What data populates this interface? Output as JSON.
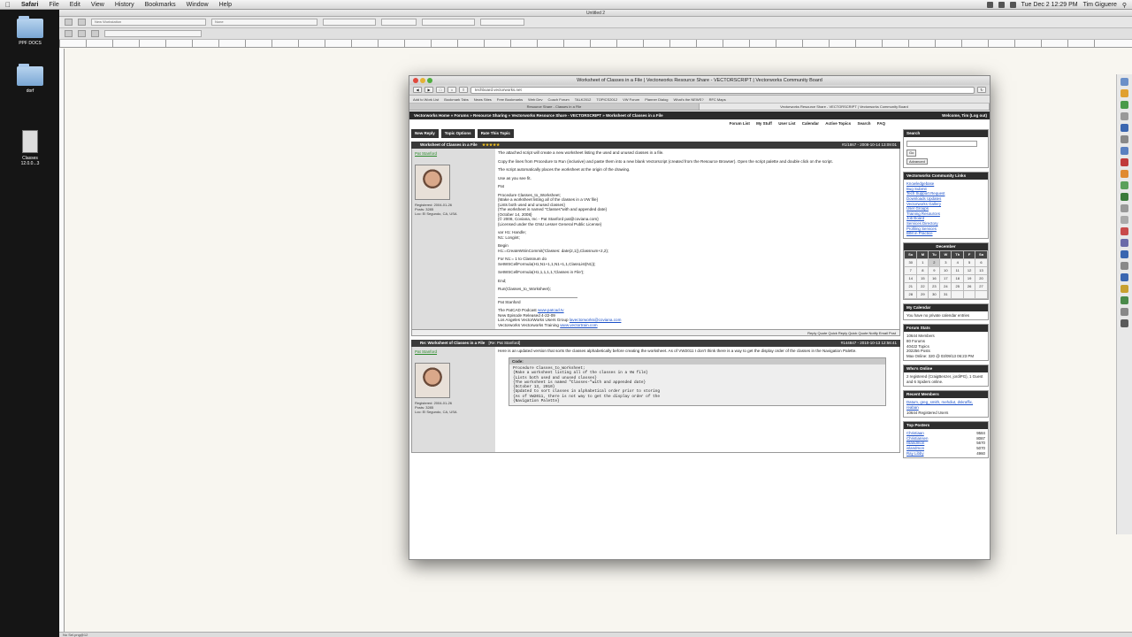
{
  "menubar": {
    "items": [
      "Safari",
      "File",
      "Edit",
      "View",
      "History",
      "Bookmarks",
      "Window",
      "Help"
    ],
    "clock": "Tue Dec 2  12:29 PM",
    "user": "Tim Giguere"
  },
  "desktop": {
    "icons": [
      "PPF DOCS",
      "dorf",
      "Classes 12.0.0...3"
    ]
  },
  "vw": {
    "title": "Untitled 2",
    "layer_box": "New Workstation",
    "class_box": "None",
    "status": "No Sel.png@12"
  },
  "safari": {
    "title": "Worksheet of Classes in a File | Vectorworks Resource Share - VECTORSCRIPT | Vectorworks Community Board",
    "url": "techboard.vectorworks.net",
    "bookmarks": [
      "Add to Work List",
      "Bookmark Tabs",
      "News Sites",
      "Free Bookmarks",
      "Web Dev",
      "Coach Forum",
      "TALK2012",
      "TOPICS2012",
      "VW Forum",
      "Planner Dialog",
      "What's the NEWS?",
      "RFC Maps"
    ],
    "tabs": [
      "Resource Share - Classes in a File",
      "Vectorworks Resource Share - VECTORSCRIPT | Vectorworks Community Board"
    ]
  },
  "forum": {
    "breadcrumb": "Vectorworks Home » Forums » Resource Sharing » Vectorworks Resource Share - VECTORSCRIPT » Worksheet of Classes in a File",
    "welcome": "Welcome, Tim (Log out)",
    "links": [
      "Forum List",
      "My Stuff",
      "User List",
      "Calendar",
      "Active Topics",
      "Search",
      "FAQ"
    ],
    "buttons": [
      "New Reply",
      "Topic Options",
      "Rate This Topic"
    ],
    "post1": {
      "subject": "Worksheet of Classes in a File",
      "date": "#1/1867 - 2008-10-14 13:09:01",
      "user": "Pat Stanford",
      "user_meta": [
        "Registered: 2004-01-26",
        "Posts: 3285",
        "Loc: El Segundo, CA, USA"
      ],
      "paragraphs": [
        "The attached script will create a new worksheet listing the used and unused classes in a file.",
        "Copy the lines from Procedure to Run (inclusive) and paste them into a new blank Vectorscript (created from the Resource Browser). Open the script palette and double click on the script.",
        "The script automatically places the worksheet at the origin of the drawing.",
        "Use as you see fit.",
        "Pat"
      ],
      "code_lines": [
        "Procedure Classes_to_Worksheet;",
        "{Make a worksheet listing all of the classes in a VW file}",
        "{Lists both used and unused classes}",
        "{The worksheet is named \"Classes\"with and appended date}",
        "{October 14, 2008}",
        "{© 2008, Coviana, Inc - Pat Stanford pat@coviana.com}",
        "{Licensed under the GNU Lesser General Public License}",
        "",
        "var H1: Handle;",
        "N1: Longint;",
        "",
        "Begin",
        "H1:=CreateWSinCommit('Classes: date(2,1)),Classnum+2,2);",
        "",
        "For N1:= 1 to Classnum do",
        "SetWSCellFormula(H1,N1+1,1,N1+1,1,ClassList(N1));",
        "",
        "SetWSCellFormula(H1,1,1,1,1,'Classes in File');",
        "",
        "End;",
        "",
        "Run(Classes_to_Worksheet);"
      ],
      "sig_name": "Pat Stanford",
      "sig_line1_prefix": "The PatCAD Podcast",
      "sig_line1_link": "www.patcad.tv",
      "sig_line2": "New Episode Released 4-22-09",
      "sig_line3_prefix": "Los Angeles VectorWorks Users Group",
      "sig_line3_link": "lavectorworks@coviana.com",
      "sig_line4_prefix": "Vectorworks Vectorworks Training",
      "sig_line4_link": "www.vectortrain.com",
      "actions": "Reply  Quote  Quick Reply  Quick Quote  Notify  Email Post"
    },
    "post2": {
      "subject": "Re: Worksheet of Classes in a File",
      "subject_by": "[Re: Pat Stanford]",
      "date": "#144847 - 2010-10-13 12:56:41",
      "user": "Pat Stanford",
      "user_meta": [
        "Registered: 2004-01-26",
        "Posts: 3285",
        "Loc: El Segundo, CA, USA"
      ],
      "intro": "Here is an updated version that sorts the classes alphabetically before creating the worksheet. As of VW2011 I don't think there is a way to get the display order of the classes in the Navigation Palette.",
      "code_label": "Code:",
      "code": "Procedure Classes_to_Worksheet;\n{Make a worksheet listing all of the classes in a VW file}\n{Lists both used and unused classes}\n{The worksheet is named \"Classes-\"with and appended date}\n{October 13, 2010}\n{Updated to sort classes in alphabetical order prior to storing\n{As of VW2011, there is not way to get the display order of the\n{Navigation Palette}"
    }
  },
  "sidebar": {
    "search_title": "Search",
    "search_go": "Go",
    "search_advanced": "Advanced",
    "links_title": "Vectorworks Community Links",
    "links": [
      "Knowledgebase",
      "Bug Submit",
      "Tech Support Request",
      "Downloads Updates",
      "Vectorworks Gallery",
      "User Groups",
      "Training Resources",
      "Job Board",
      "Services Directory",
      "Profiling Services",
      "BIM in Practice"
    ],
    "calendar_title": "December",
    "cal_dow": [
      "Su",
      "M",
      "Tu",
      "W",
      "Th",
      "F",
      "Sa"
    ],
    "cal_weeks": [
      [
        "30",
        "1",
        "2",
        "3",
        "4",
        "5",
        "6"
      ],
      [
        "7",
        "8",
        "9",
        "10",
        "11",
        "12",
        "13"
      ],
      [
        "14",
        "15",
        "16",
        "17",
        "18",
        "19",
        "20"
      ],
      [
        "21",
        "22",
        "23",
        "24",
        "25",
        "26",
        "27"
      ],
      [
        "28",
        "29",
        "30",
        "31",
        "",
        "",
        ""
      ]
    ],
    "mycal_title": "My Calendar",
    "mycal_text": "You have no private calendar entries",
    "stats_title": "Forum Stats",
    "stats": [
      "10644 Members",
      "80 Forums",
      "40422 Topics",
      "202256 Posts"
    ],
    "stats_extra": "Max Online: 320 @ 03/09/13 06:23 PM",
    "online_title": "Who's Online",
    "online_text": "2 registered (CraigBenzer, jordiPG), 1 Guest and 6 Spiders online.",
    "recent_title": "Recent Members",
    "recent_text": "Datum, greg_smith, mehdiut, dskraffix, reaban",
    "recent_count": "10644 Registered Users",
    "top_title": "Top Posters",
    "top_posters": [
      {
        "name": "Christiaan",
        "count": "9584"
      },
      {
        "name": "Christiansen",
        "count": "8087"
      },
      {
        "name": "Islandmon",
        "count": "5670"
      },
      {
        "name": "islandmon",
        "count": "5070"
      },
      {
        "name": "Ray Libby",
        "count": "4960"
      }
    ]
  }
}
